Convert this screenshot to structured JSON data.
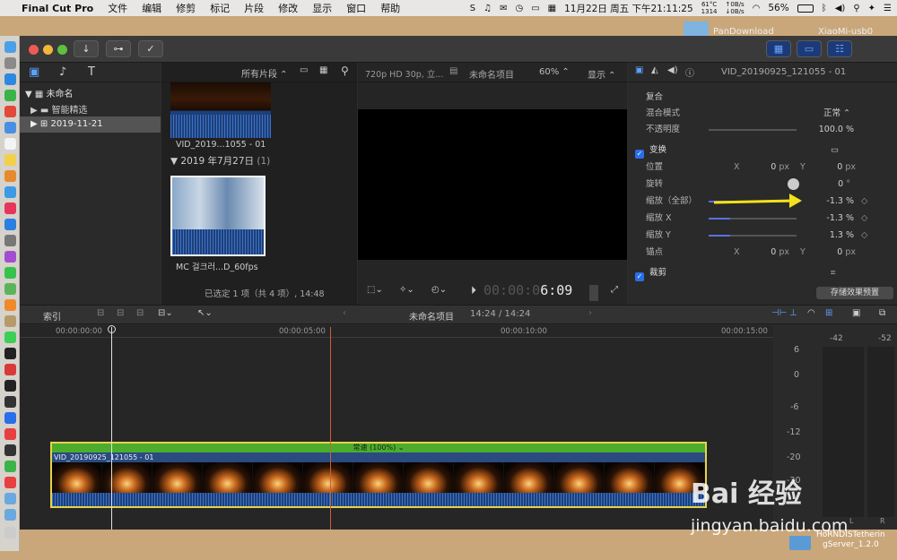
{
  "menubar": {
    "app_name": "Final Cut Pro",
    "items": [
      "文件",
      "编辑",
      "修剪",
      "标记",
      "片段",
      "修改",
      "显示",
      "窗口",
      "帮助"
    ],
    "net_temp": "61°C",
    "net_rpm": "1314",
    "net_up": "0B/s",
    "net_down": "0B/s",
    "datetime": "11月22日 周五 下午21:11:25",
    "battery": "56%"
  },
  "desktop": {
    "folder_label": "PanDownload",
    "device_label": "XiaoMi-usb0",
    "file_line1": "HoRNDISTetherin",
    "file_line2": "gServer_1.2.0"
  },
  "browser": {
    "library": "未命名",
    "smart_collections": "智能精选",
    "event": "2019-11-21",
    "filter": "所有片段",
    "clip1_name": "VID_2019...1055 - 01",
    "date_group": "2019 年7月27日",
    "date_count": "(1)",
    "clip2_name": "MC 걸크러...D_60fps",
    "status": "已选定 1 项（共 4 项）, 14:48"
  },
  "viewer": {
    "format": "720p HD 30p, 立...",
    "project": "未命名项目",
    "zoom": "60%",
    "display": "显示",
    "timecode": "00:00:06:09",
    "timecode_dim": "00:00:0",
    "timecode_bright": "6:09"
  },
  "inspector": {
    "clip_name": "VID_20190925_121055 - 01",
    "composite": "复合",
    "blend_label": "混合模式",
    "blend_value": "正常",
    "opacity_label": "不透明度",
    "opacity_value": "100.0",
    "opacity_unit": "%",
    "transform": "变换",
    "position_label": "位置",
    "x_label": "X",
    "y_label": "Y",
    "pos_x": "0",
    "pos_y": "0",
    "px_unit": "px",
    "rotation_label": "旋转",
    "rotation_value": "0",
    "deg_unit": "°",
    "scale_all_label": "缩放（全部）",
    "scale_all_value": "-1.3",
    "scale_x_label": "缩放 X",
    "scale_x_value": "-1.3",
    "scale_y_label": "缩放 Y",
    "scale_y_value": "1.3",
    "pct_unit": "%",
    "anchor_label": "锚点",
    "anchor_x": "0",
    "anchor_y": "0",
    "crop": "裁剪",
    "save_preset": "存储效果预置"
  },
  "timeline": {
    "index": "索引",
    "project": "未命名项目",
    "duration": "14:24 / 14:24",
    "ruler": [
      "00:00:00:00",
      "00:00:05:00",
      "00:00:10:00",
      "00:00:15:00"
    ],
    "speed": "常速 (100%)",
    "clip_name": "VID_20190925_121055 - 01"
  },
  "meters": {
    "top_left": "-42",
    "top_right": "-52",
    "scale": [
      "6",
      "0",
      "-6",
      "-12",
      "-20",
      "-30"
    ],
    "left_channel": "L",
    "right_channel": "R"
  },
  "watermark": {
    "brand": "Bai 经验",
    "url": "jingyan.baidu.com"
  },
  "colors": {
    "accent": "#2a6ee8",
    "clip_green": "#4cad2c",
    "clip_yellow": "#e8d34a",
    "playhead": "#c8603a",
    "arrow": "#f2e21b"
  }
}
